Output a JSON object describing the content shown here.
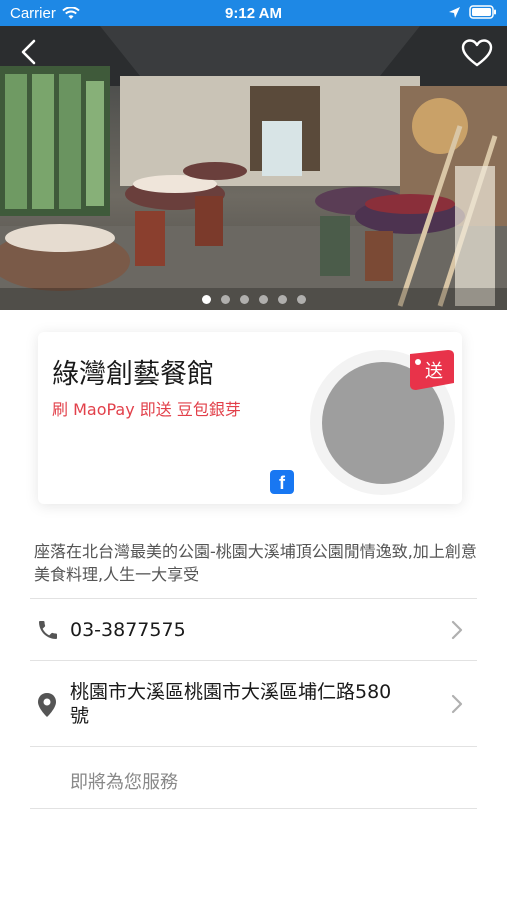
{
  "status_bar": {
    "carrier": "Carrier",
    "time": "9:12 AM"
  },
  "hero": {
    "image_alt": "restaurant dining room",
    "slides": 6,
    "active_slide": 0
  },
  "restaurant": {
    "name": "綠灣創藝餐館",
    "promo": "刷 MaoPay 即送 豆包銀芽",
    "badge": "送",
    "description": "座落在北台灣最美的公園-桃園大溪埔頂公園閒情逸致,加上創意美食料理,人生一大享受"
  },
  "contact": {
    "phone": "03-3877575",
    "address": "桃園市大溪區桃園市大溪區埔仁路580號"
  },
  "service_text": "即將為您服務",
  "colors": {
    "status_bar": "#1e88e5",
    "promo": "#e2404a",
    "badge": "#e8334a",
    "facebook": "#1877f2"
  },
  "icons": [
    "back-icon",
    "heart-icon",
    "facebook-icon",
    "phone-icon",
    "location-pin-icon",
    "chevron-right-icon"
  ]
}
